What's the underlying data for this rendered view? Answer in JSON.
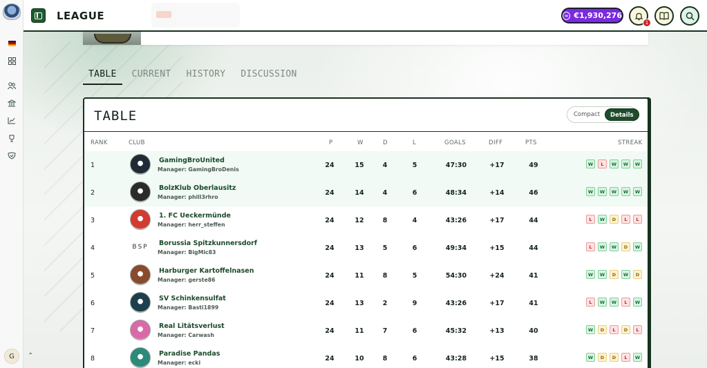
{
  "header": {
    "title": "LEAGUE",
    "balance": "€1,930,276",
    "notification_count": "1"
  },
  "user": {
    "initial": "G"
  },
  "tabs": [
    {
      "label": "TABLE",
      "active": true
    },
    {
      "label": "CURRENT",
      "active": false
    },
    {
      "label": "HISTORY",
      "active": false
    },
    {
      "label": "DISCUSSION",
      "active": false
    }
  ],
  "table": {
    "title": "TABLE",
    "view_options": [
      "Compact",
      "Details"
    ],
    "selected_view": "Details",
    "columns": [
      "RANK",
      "CLUB",
      "P",
      "W",
      "D",
      "L",
      "GOALS",
      "DIFF",
      "PTS",
      "STREAK"
    ],
    "rows": [
      {
        "rank": "1",
        "club": "GamingBroUnited",
        "manager": "Manager: GamingBroDenis",
        "p": "24",
        "w": "15",
        "d": "4",
        "l": "5",
        "goals": "47:30",
        "diff": "+17",
        "pts": "49",
        "streak": [
          "W",
          "L",
          "W",
          "W",
          "W"
        ],
        "crest_color": "#1f2a36"
      },
      {
        "rank": "2",
        "club": "BolzKlub Oberlausitz",
        "manager": "Manager: phill3rhro",
        "p": "24",
        "w": "14",
        "d": "4",
        "l": "6",
        "goals": "48:34",
        "diff": "+14",
        "pts": "46",
        "streak": [
          "W",
          "W",
          "W",
          "W",
          "W"
        ],
        "crest_color": "#2b2b2b"
      },
      {
        "rank": "3",
        "club": "1. FC Ueckermünde",
        "manager": "Manager: herr_steffen",
        "p": "24",
        "w": "12",
        "d": "8",
        "l": "4",
        "goals": "43:26",
        "diff": "+17",
        "pts": "44",
        "streak": [
          "L",
          "W",
          "D",
          "L",
          "L"
        ],
        "crest_color": "#d23b2f"
      },
      {
        "rank": "4",
        "club": "Borussia Spitzkunnersdorf",
        "manager": "Manager: BigMic83",
        "p": "24",
        "w": "13",
        "d": "5",
        "l": "6",
        "goals": "49:34",
        "diff": "+15",
        "pts": "44",
        "streak": [
          "L",
          "W",
          "W",
          "D",
          "W"
        ],
        "crest_text": "BSP"
      },
      {
        "rank": "5",
        "club": "Harburger Kartoffelnasen",
        "manager": "Manager: gerste86",
        "p": "24",
        "w": "11",
        "d": "8",
        "l": "5",
        "goals": "54:30",
        "diff": "+24",
        "pts": "41",
        "streak": [
          "W",
          "W",
          "D",
          "W",
          "D"
        ],
        "crest_color": "#8a4a2e"
      },
      {
        "rank": "6",
        "club": "SV Schinkensulfat",
        "manager": "Manager: Basti1899",
        "p": "24",
        "w": "13",
        "d": "2",
        "l": "9",
        "goals": "43:26",
        "diff": "+17",
        "pts": "41",
        "streak": [
          "L",
          "W",
          "W",
          "L",
          "W"
        ],
        "crest_color": "#1b3f4d"
      },
      {
        "rank": "7",
        "club": "Real Litätsverlust",
        "manager": "Manager: Carwash",
        "p": "24",
        "w": "11",
        "d": "7",
        "l": "6",
        "goals": "45:32",
        "diff": "+13",
        "pts": "40",
        "streak": [
          "W",
          "D",
          "L",
          "D",
          "L"
        ],
        "crest_color": "#d96aa8"
      },
      {
        "rank": "8",
        "club": "Paradise Pandas",
        "manager": "Manager: ecki",
        "p": "24",
        "w": "10",
        "d": "8",
        "l": "6",
        "goals": "43:28",
        "diff": "+15",
        "pts": "38",
        "streak": [
          "W",
          "D",
          "D",
          "L",
          "W"
        ],
        "crest_color": "#2c8a7a"
      }
    ]
  },
  "colors": {
    "accent": "#1e4d2b",
    "balance": "#7a2be0",
    "win": "#d8f5e2",
    "loss": "#fde2e2",
    "draw": "#fdf2cf"
  },
  "icons": [
    "sidebar-toggle-icon",
    "bell-icon",
    "book-icon",
    "search-icon",
    "dashboard-icon",
    "users-icon",
    "bank-icon",
    "chart-icon",
    "trophy-icon",
    "shield-icon",
    "flag-icon",
    "link-icon",
    "chevron-up-down-icon"
  ]
}
